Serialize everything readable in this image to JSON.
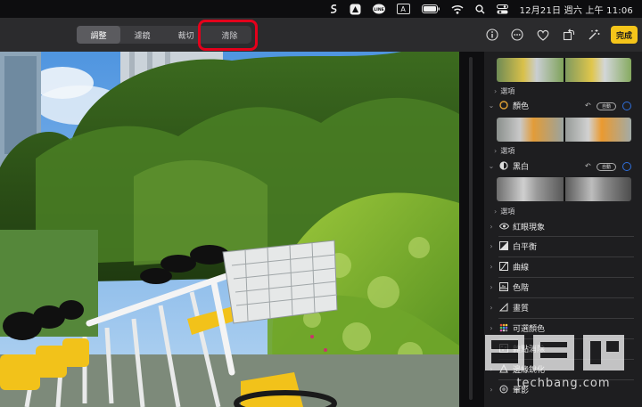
{
  "menubar": {
    "clock": "12月21日 週六 上午 11:06",
    "input_badge": "A",
    "icons": [
      "scribble-icon",
      "notch-app-icon",
      "line-icon",
      "input-method-icon",
      "battery-icon",
      "wifi-icon",
      "search-icon",
      "control-center-icon"
    ]
  },
  "toolbar": {
    "tabs": [
      {
        "label": "調整",
        "active": true
      },
      {
        "label": "濾鏡",
        "active": false
      },
      {
        "label": "裁切",
        "active": false
      },
      {
        "label": "清除",
        "active": false
      }
    ],
    "done_label": "完成",
    "icons": [
      "info-icon",
      "more-icon",
      "favorite-heart-icon",
      "rotate-icon",
      "magic-wand-icon"
    ],
    "accent_color": "#f5c51a",
    "highlight_color": "#e4001b"
  },
  "sidebar": {
    "options_label": "選項",
    "auto_label": "自動",
    "sections": [
      {
        "name": "顏色",
        "expanded": true
      },
      {
        "name": "黑白",
        "expanded": true
      },
      {
        "name": "紅眼現象"
      },
      {
        "name": "白平衡"
      },
      {
        "name": "曲線"
      },
      {
        "name": "色階"
      },
      {
        "name": "畫質"
      },
      {
        "name": "可選顏色"
      },
      {
        "name": "雜點消除"
      },
      {
        "name": "邊緣銳化"
      },
      {
        "name": "暈影"
      }
    ]
  },
  "watermark": {
    "main": "電腦王",
    "sub": "techbang.com"
  }
}
